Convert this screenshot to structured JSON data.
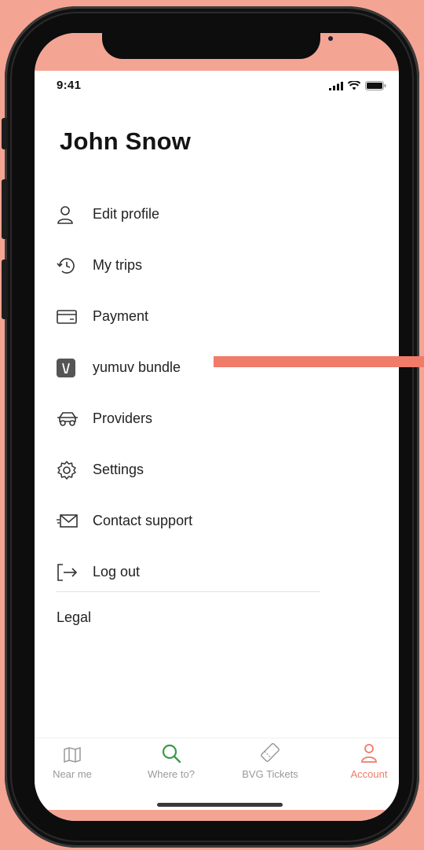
{
  "status_bar": {
    "time": "9:41"
  },
  "profile": {
    "name": "John Snow"
  },
  "menu": {
    "items": [
      {
        "label": "Edit profile",
        "icon": "person-icon"
      },
      {
        "label": "My trips",
        "icon": "history-icon"
      },
      {
        "label": "Payment",
        "icon": "card-icon"
      },
      {
        "label": "yumuv bundle",
        "icon": "yumuv-logo-icon"
      },
      {
        "label": "Providers",
        "icon": "car-icon"
      },
      {
        "label": "Settings",
        "icon": "gear-icon"
      },
      {
        "label": "Contact support",
        "icon": "mail-icon"
      },
      {
        "label": "Log out",
        "icon": "logout-icon"
      }
    ],
    "legal_label": "Legal"
  },
  "tabbar": {
    "tabs": [
      {
        "label": "Near me",
        "icon": "map-icon",
        "active": false
      },
      {
        "label": "Where to?",
        "icon": "search-icon",
        "active": false
      },
      {
        "label": "BVG Tickets",
        "icon": "ticket-icon",
        "active": false
      },
      {
        "label": "Account",
        "icon": "person-icon",
        "active": true
      }
    ]
  },
  "colors": {
    "background": "#f4a493",
    "accent": "#f17b69",
    "where_to_green": "#3a9a48",
    "account_active": "#f17b69"
  }
}
